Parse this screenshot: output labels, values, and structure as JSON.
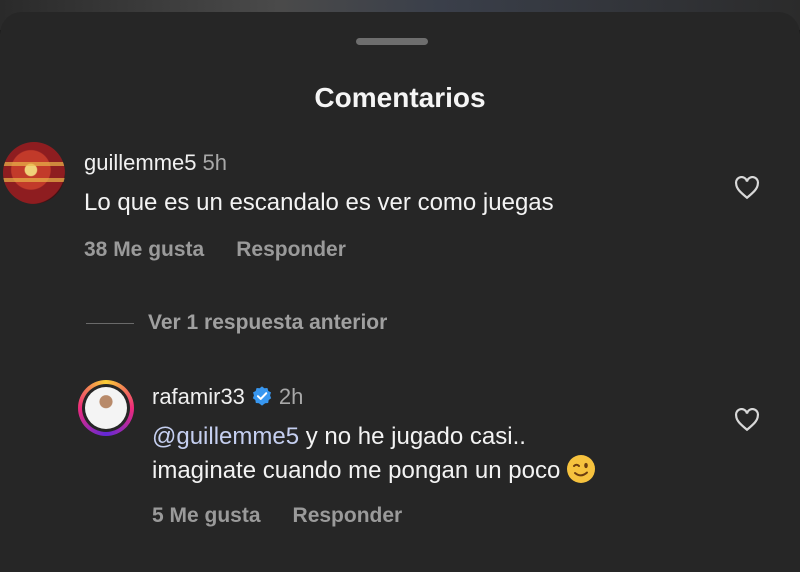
{
  "sheet": {
    "title": "Comentarios"
  },
  "comments": [
    {
      "username": "guillemme5",
      "time": "5h",
      "text": "Lo que es un escandalo es ver como juegas",
      "likes": "38 Me gusta",
      "reply_label": "Responder"
    }
  ],
  "replies_toggle": {
    "label": "Ver 1 respuesta anterior"
  },
  "reply": {
    "username": "rafamir33",
    "verified": true,
    "time": "2h",
    "mention": "@guillemme5",
    "text_line1": " y no he jugado casi..",
    "text_line2": "imaginate cuando me pongan un poco",
    "emoji": "winking-face",
    "likes": "5 Me gusta",
    "reply_label": "Responder"
  },
  "colors": {
    "sheet_background": "#262626",
    "verified_badge": "#3897f0",
    "secondary_text": "#9a9a9a"
  }
}
